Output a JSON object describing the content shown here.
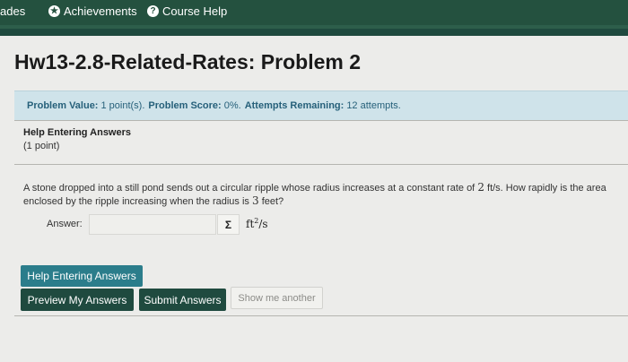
{
  "nav": {
    "partial_label": "ades",
    "achievements": "Achievements",
    "course_help": "Course Help",
    "achievements_icon": "star-icon",
    "course_help_icon": "question-icon"
  },
  "page_title": "Hw13-2.8-Related-Rates: Problem 2",
  "info": {
    "value_label": "Problem Value:",
    "value": "1 point(s).",
    "score_label": "Problem Score:",
    "score": "0%.",
    "attempts_label": "Attempts Remaining:",
    "attempts": "12 attempts."
  },
  "help": {
    "title": "Help Entering Answers",
    "points": "(1 point)"
  },
  "question": {
    "text1": "A stone dropped into a still pond sends out a circular ripple whose radius increases at a constant rate of",
    "rate": "2",
    "text2": "ft/s. How rapidly is the area enclosed by the ripple increasing when the radius is",
    "radius": "3",
    "text3": "feet?"
  },
  "answer": {
    "label": "Answer:",
    "value": "",
    "sigma": "Σ",
    "unit_base": "ft",
    "unit_exp": "2",
    "unit_tail": "/s"
  },
  "buttons": {
    "help": "Help Entering Answers",
    "preview": "Preview My Answers",
    "submit": "Submit Answers",
    "show_another": "Show me another"
  },
  "colors": {
    "topbar": "#24513f",
    "info_bg": "#cfe3ea",
    "info_text": "#26607a",
    "help_button": "#2b7d8b",
    "primary_button": "#1f4a3f"
  }
}
